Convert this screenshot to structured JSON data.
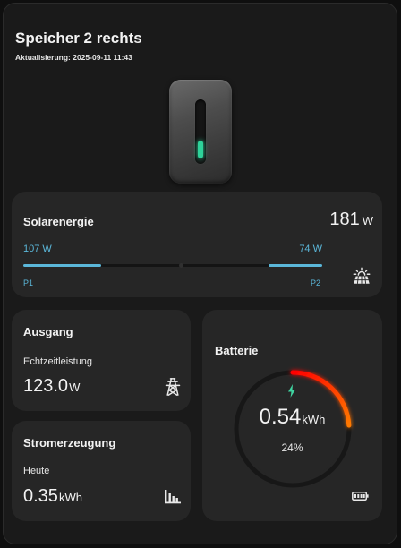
{
  "header": {
    "title": "Speicher 2 rechts",
    "updated": "Aktualisierung: 2025-09-11 11:43"
  },
  "solar": {
    "title": "Solarenergie",
    "total_value": "181",
    "total_unit": "W",
    "p1_value": "107 W",
    "p2_value": "74 W",
    "p1_label": "P1",
    "p2_label": "P2",
    "p1_fill_fraction": 0.26,
    "p2_fill_fraction": 0.18,
    "icon": "solar-panel-icon",
    "accent_color": "#5bb7d9"
  },
  "output": {
    "title": "Ausgang",
    "label": "Echtzeitleistung",
    "value": "123.0",
    "unit": "W",
    "icon": "transmission-tower-icon"
  },
  "generation": {
    "title": "Stromerzeugung",
    "label": "Heute",
    "value": "0.35",
    "unit": "kWh",
    "icon": "bar-chart-icon"
  },
  "battery": {
    "title": "Batterie",
    "value": "0.54",
    "unit": "kWh",
    "percent": "24%",
    "level_fraction": 0.24,
    "icons": [
      "lightning-bolt-icon",
      "battery-icon"
    ],
    "gauge_colors": [
      "#ff0000",
      "#ff7a00"
    ]
  }
}
